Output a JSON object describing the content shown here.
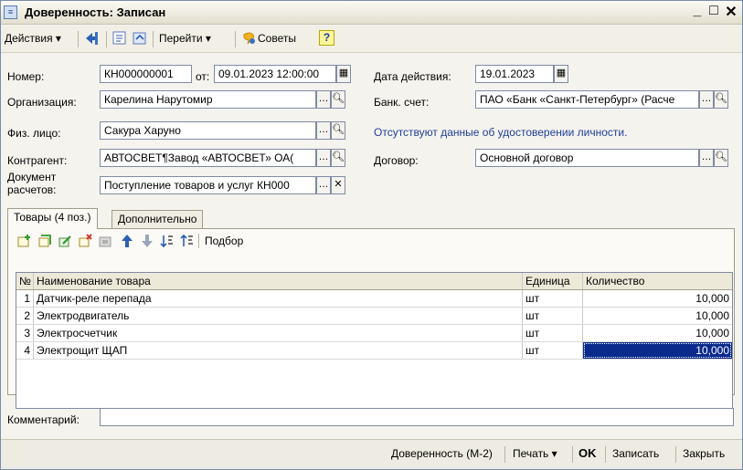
{
  "window": {
    "title": "Доверенность: Записан",
    "minimize": "_",
    "maximize": "□",
    "close": "✕"
  },
  "toolbar": {
    "actions_label": "Действия ▾",
    "goto_label": "Перейти ▾",
    "tips_label": "Советы",
    "help_label": "?"
  },
  "form": {
    "number_label": "Номер:",
    "number_value": "КН000000001",
    "from_label": "от:",
    "date_value": "09.01.2023 12:00:00",
    "valid_label": "Дата действия:",
    "valid_value": "19.01.2023",
    "org_label": "Организация:",
    "org_value": "Карелина Нарутомир",
    "bank_label": "Банк. счет:",
    "bank_value": "ПАО «Банк «Санкт-Петербург» (Расче",
    "person_label": "Физ. лицо:",
    "person_value": "Сакура Харуно",
    "no_id_message": "Отсутствуют данные об удостоверении личности.",
    "counterparty_label": "Контрагент:",
    "counterparty_value": "АВТОСВЕТ¶Завод «АВТОСВЕТ» ОА(",
    "contract_label": "Договор:",
    "contract_value": "Основной договор",
    "settlement_label_line1": "Документ",
    "settlement_label_line2": "расчетов:",
    "settlement_value": "Поступление товаров и услуг КН000"
  },
  "tabs": [
    {
      "label": "Товары (4 поз.)"
    },
    {
      "label": "Дополнительно"
    }
  ],
  "tab_toolbar": {
    "pick_label": "Подбор"
  },
  "grid": {
    "columns": [
      "№",
      "Наименование товара",
      "Единица",
      "Количество"
    ],
    "rows": [
      {
        "n": "1",
        "name": "Датчик-реле перепада",
        "unit": "шт",
        "qty": "10,000"
      },
      {
        "n": "2",
        "name": "Электродвигатель",
        "unit": "шт",
        "qty": "10,000"
      },
      {
        "n": "3",
        "name": "Электросчетчик",
        "unit": "шт",
        "qty": "10,000"
      },
      {
        "n": "4",
        "name": "Электрощит ЩАП",
        "unit": "шт",
        "qty": "10,000"
      }
    ]
  },
  "comment_label": "Комментарий:",
  "comment_value": "",
  "bottom": {
    "print_form_label": "Доверенность (М-2)",
    "print_label": "Печать ▾",
    "ok_label": "OK",
    "save_label": "Записать",
    "close_label": "Закрыть"
  },
  "colors": {
    "accent_blue": "#1f3f9a",
    "selection": "#0a2a8c"
  }
}
